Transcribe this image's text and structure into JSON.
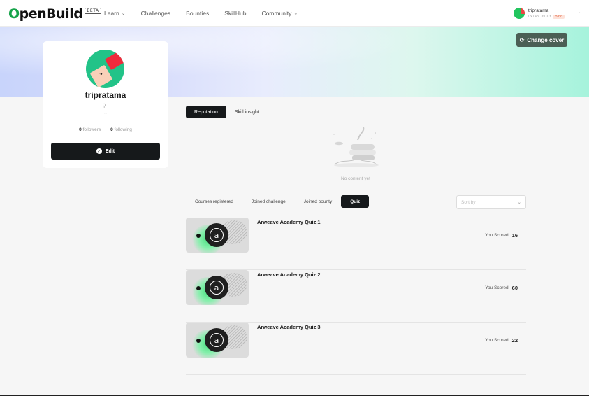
{
  "header": {
    "logo": "OpenBuild",
    "beta": "BETA",
    "nav": [
      {
        "label": "Learn",
        "dropdown": true
      },
      {
        "label": "Challenges",
        "dropdown": false
      },
      {
        "label": "Bounties",
        "dropdown": false
      },
      {
        "label": "SkillHub",
        "dropdown": false
      },
      {
        "label": "Community",
        "dropdown": true
      }
    ],
    "user": {
      "name": "tripratama",
      "address": "0x148...6CCf",
      "tag": "Bind"
    }
  },
  "cover": {
    "change_cover_label": "Change cover"
  },
  "profile": {
    "username": "tripratama",
    "location": ".",
    "bio": "--",
    "followers_count": "0",
    "followers_label": "followers",
    "following_count": "0",
    "following_label": "following",
    "edit_label": "Edit"
  },
  "reputation_tabs": {
    "items": [
      "Reputation",
      "Skill insight"
    ],
    "active": 0
  },
  "empty_state": {
    "text": "No content yet"
  },
  "filter_tabs": {
    "items": [
      "Courses registered",
      "Joined challenge",
      "Joined bounty",
      "Quiz"
    ],
    "active": 3,
    "sort_placeholder": "Sort by"
  },
  "quizzes": [
    {
      "title": "Arweave Academy Quiz 1",
      "score_label": "You Scored",
      "score": "16"
    },
    {
      "title": "Arweave Academy Quiz 2",
      "score_label": "You Scored",
      "score": "60"
    },
    {
      "title": "Arweave Academy Quiz 3",
      "score_label": "You Scored",
      "score": "22"
    }
  ],
  "colors": {
    "primary_dark": "#16191b",
    "brand_green": "#16a34a",
    "tag_bg": "#fde2d9"
  }
}
